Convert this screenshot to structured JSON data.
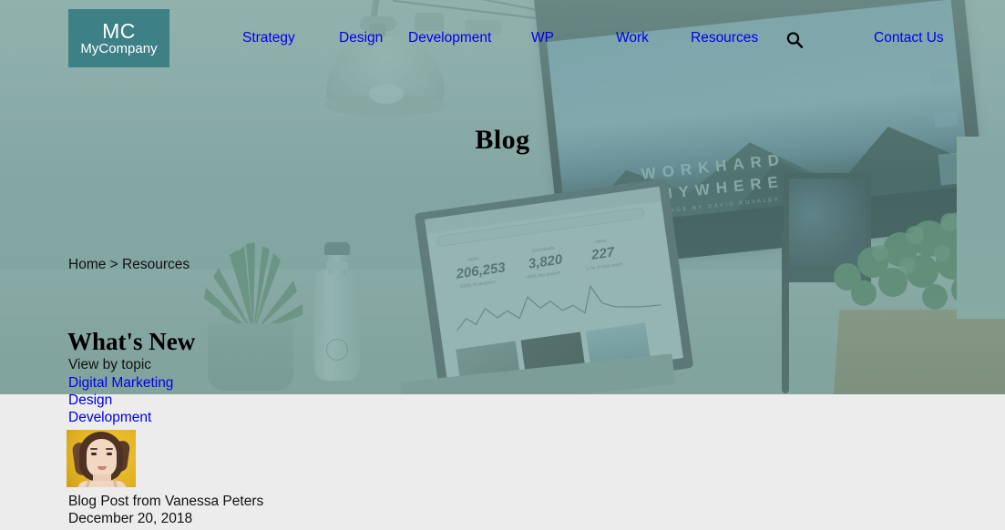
{
  "brand": {
    "logo_initials": "MC",
    "logo_name": "MyCompany",
    "logo_bg_color": "#3d8086",
    "logo_text_color": "#ffffff"
  },
  "colors": {
    "link": "#0000EE",
    "page_bg": "#ececec",
    "hero_overlay": "#4c8a8c",
    "text": "#111111"
  },
  "nav": {
    "items": [
      {
        "label": "Strategy"
      },
      {
        "label": "Design"
      },
      {
        "label": "Development"
      },
      {
        "label": "WP"
      },
      {
        "label": "Work"
      },
      {
        "label": "Resources"
      },
      {
        "label": "Contact Us"
      }
    ],
    "search_icon": "search-icon"
  },
  "hero": {
    "title": "Blog",
    "photo_description": "desk workspace with laptop, monitor, plants, lamp and water bottle",
    "monitor_text_line1": "WORKHARD",
    "monitor_text_line2": "ANYWHERE",
    "monitor_text_line3": "IMAGE BY DAVID KOVALEV",
    "laptop_stats": [
      {
        "label": "Views",
        "value": "206,253",
        "sub": "100% of sessions"
      },
      {
        "label": "Downloads",
        "value": "3,820",
        "sub": "+40% this quarter"
      },
      {
        "label": "Likes",
        "value": "227",
        "sub": "17% of total reach"
      }
    ]
  },
  "breadcrumb": {
    "text": "Home > Resources",
    "home": "Home",
    "separator": ">",
    "current": "Resources"
  },
  "content": {
    "heading": "What's New",
    "view_by_topic_label": "View by topic",
    "topics": [
      {
        "label": "Digital Marketing"
      },
      {
        "label": "Design"
      },
      {
        "label": "Development"
      }
    ],
    "post": {
      "avatar_alt": "portrait of a woman on a yellow background",
      "author_line": "Blog Post from Vanessa Peters",
      "date": "December 20, 2018"
    }
  }
}
